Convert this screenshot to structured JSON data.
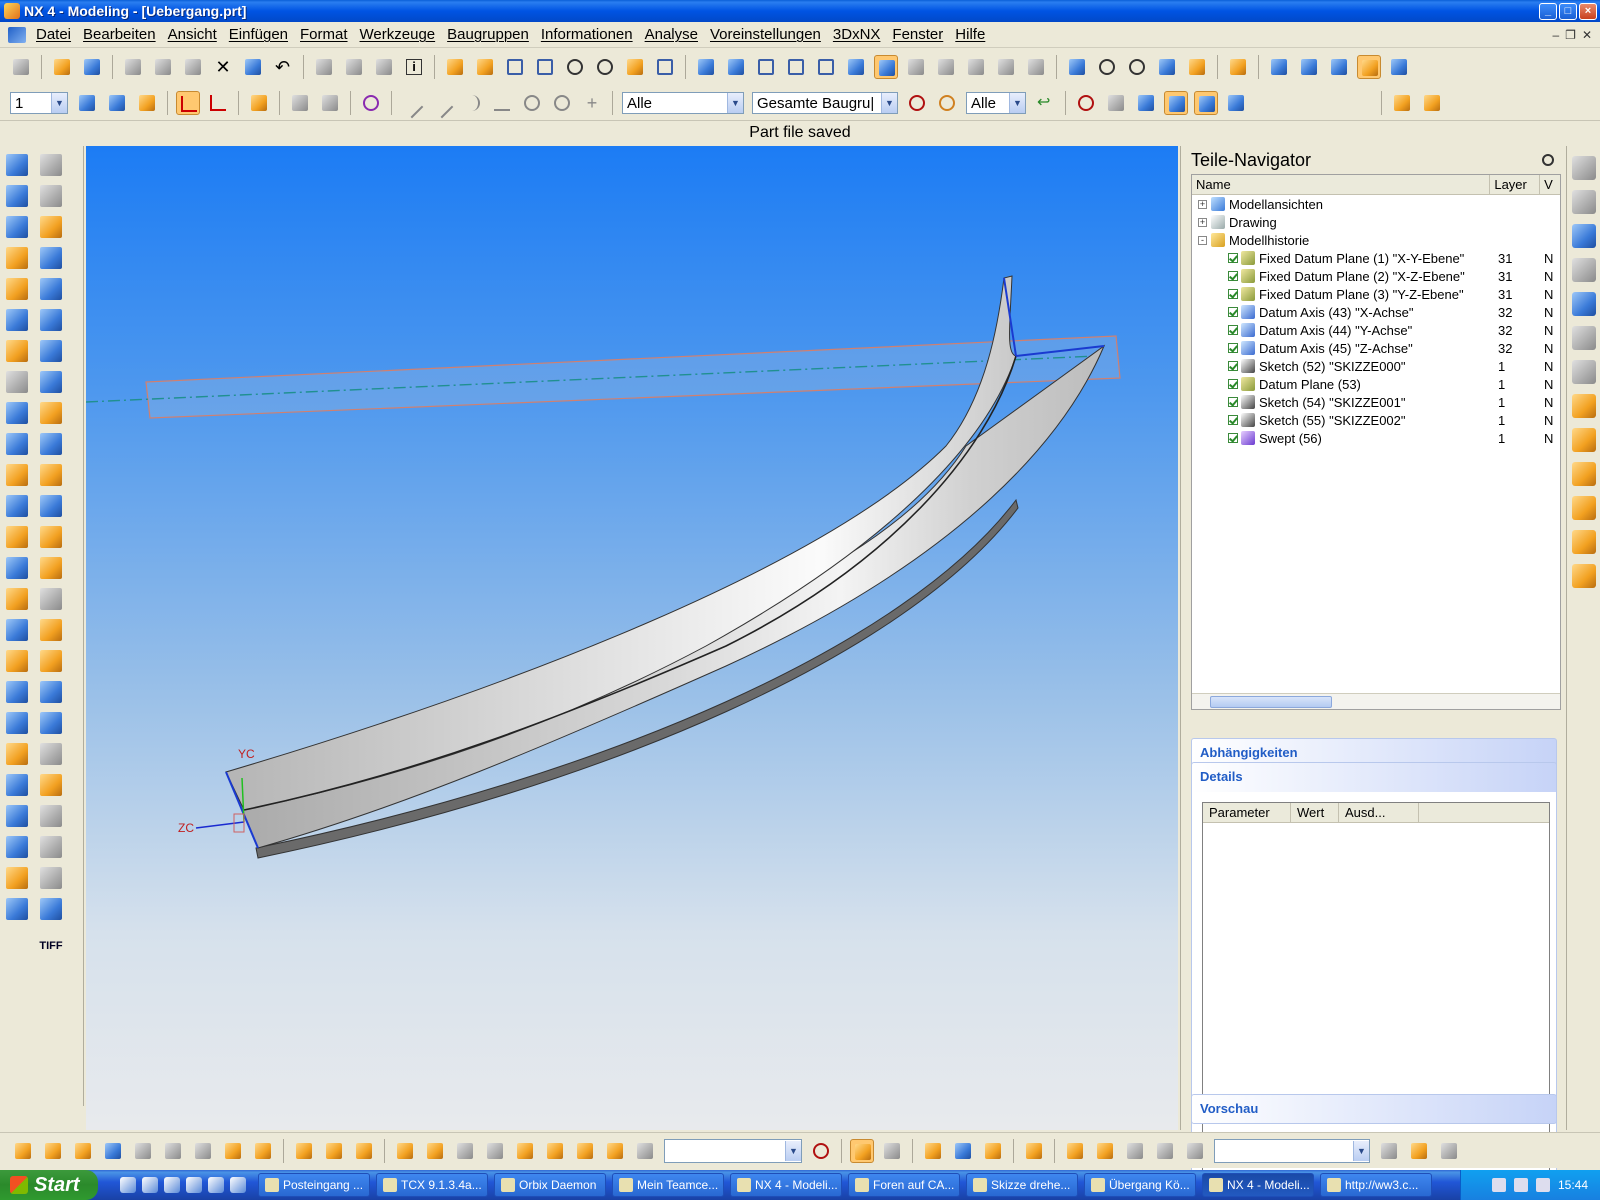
{
  "window": {
    "title": "NX 4 - Modeling - [Uebergang.prt]"
  },
  "menu": [
    "Datei",
    "Bearbeiten",
    "Ansicht",
    "Einfügen",
    "Format",
    "Werkzeuge",
    "Baugruppen",
    "Informationen",
    "Analyse",
    "Voreinstellungen",
    "3DxNX",
    "Fenster",
    "Hilfe"
  ],
  "toolbar2": {
    "layer_value": "1",
    "filter_value": "Alle",
    "scope_value": "Gesamte Baugru|",
    "filter2_value": "Alle"
  },
  "status": "Part file saved",
  "viewport": {
    "axis_yc": "YC",
    "axis_zc": "ZC"
  },
  "navigator": {
    "title": "Teile-Navigator",
    "columns": {
      "name": "Name",
      "layer": "Layer",
      "extra": "V"
    },
    "rows": [
      {
        "indent": 0,
        "toggle": "+",
        "icon": "model-views-icon",
        "label": "Modellansichten",
        "layer": "",
        "extra": ""
      },
      {
        "indent": 0,
        "toggle": "+",
        "icon": "drawing-icon",
        "label": "Drawing",
        "layer": "",
        "extra": ""
      },
      {
        "indent": 0,
        "toggle": "-",
        "icon": "folder-icon",
        "label": "Modellhistorie",
        "layer": "",
        "extra": ""
      },
      {
        "indent": 1,
        "toggle": "",
        "icon": "datum-plane-icon",
        "label": "Fixed Datum Plane (1) \"X-Y-Ebene\"",
        "layer": "31",
        "extra": "N"
      },
      {
        "indent": 1,
        "toggle": "",
        "icon": "datum-plane-icon",
        "label": "Fixed Datum Plane (2) \"X-Z-Ebene\"",
        "layer": "31",
        "extra": "N"
      },
      {
        "indent": 1,
        "toggle": "",
        "icon": "datum-plane-icon",
        "label": "Fixed Datum Plane (3) \"Y-Z-Ebene\"",
        "layer": "31",
        "extra": "N"
      },
      {
        "indent": 1,
        "toggle": "",
        "icon": "datum-axis-icon",
        "label": "Datum Axis (43) \"X-Achse\"",
        "layer": "32",
        "extra": "N"
      },
      {
        "indent": 1,
        "toggle": "",
        "icon": "datum-axis-icon",
        "label": "Datum Axis (44) \"Y-Achse\"",
        "layer": "32",
        "extra": "N"
      },
      {
        "indent": 1,
        "toggle": "",
        "icon": "datum-axis-icon",
        "label": "Datum Axis (45) \"Z-Achse\"",
        "layer": "32",
        "extra": "N"
      },
      {
        "indent": 1,
        "toggle": "",
        "icon": "sketch-icon",
        "label": "Sketch (52) \"SKIZZE000\"",
        "layer": "1",
        "extra": "N"
      },
      {
        "indent": 1,
        "toggle": "",
        "icon": "datum-plane-icon",
        "label": "Datum Plane (53)",
        "layer": "1",
        "extra": "N"
      },
      {
        "indent": 1,
        "toggle": "",
        "icon": "sketch-icon",
        "label": "Sketch (54) \"SKIZZE001\"",
        "layer": "1",
        "extra": "N"
      },
      {
        "indent": 1,
        "toggle": "",
        "icon": "sketch-icon",
        "label": "Sketch (55) \"SKIZZE002\"",
        "layer": "1",
        "extra": "N"
      },
      {
        "indent": 1,
        "toggle": "",
        "icon": "swept-icon",
        "label": "Swept (56)",
        "layer": "1",
        "extra": "N"
      }
    ],
    "sections": {
      "dependencies": "Abhängigkeiten",
      "details": "Details",
      "preview": "Vorschau"
    },
    "details_columns": [
      "Parameter",
      "Wert",
      "Ausd..."
    ]
  },
  "taskbar": {
    "start": "Start",
    "tasks": [
      {
        "label": "Posteingang ...",
        "active": false
      },
      {
        "label": "TCX 9.1.3.4a...",
        "active": false
      },
      {
        "label": "Orbix Daemon",
        "active": false
      },
      {
        "label": "Mein Teamce...",
        "active": false
      },
      {
        "label": "NX 4 - Modeli...",
        "active": false
      },
      {
        "label": "Foren auf CA...",
        "active": false
      },
      {
        "label": "Skizze drehe...",
        "active": false
      },
      {
        "label": "Übergang Kö...",
        "active": false
      },
      {
        "label": "NX 4 - Modeli...",
        "active": true
      },
      {
        "label": "http://ww3.c...",
        "active": false
      }
    ],
    "clock": "15:44"
  }
}
